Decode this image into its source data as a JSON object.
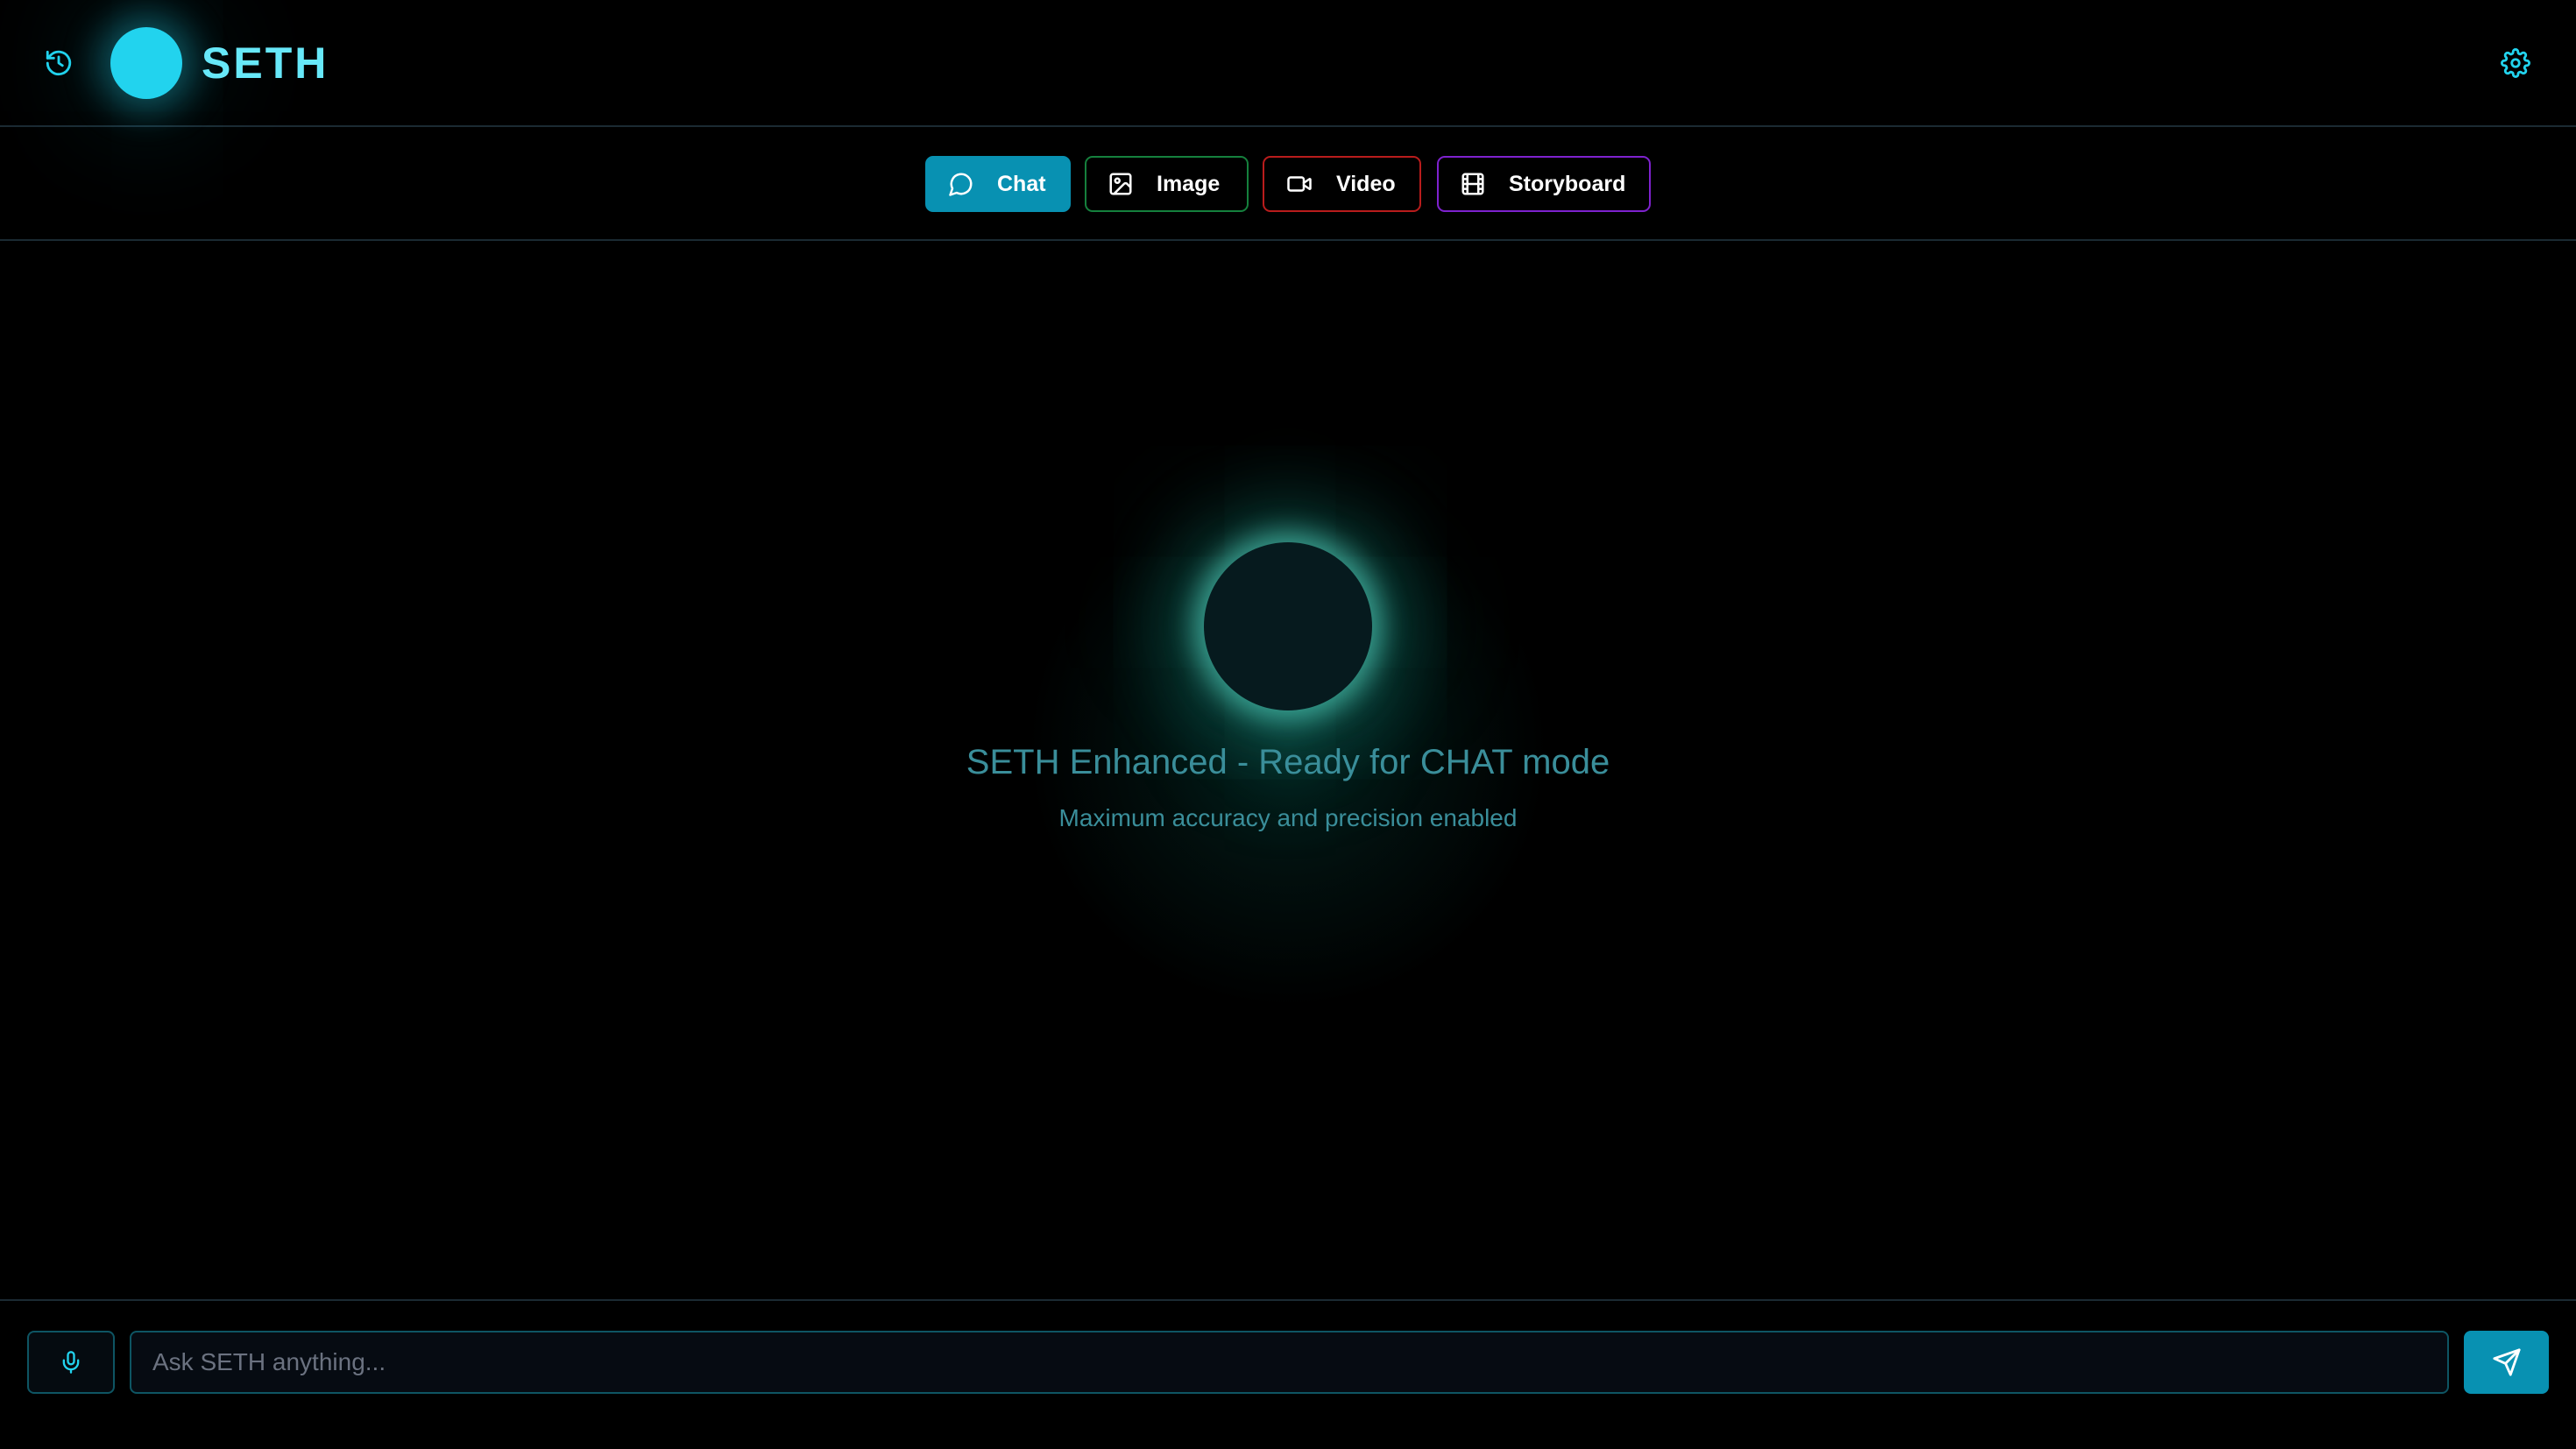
{
  "header": {
    "brand": "SETH",
    "history_icon": "history-icon",
    "settings_icon": "gear-icon",
    "logo_color": "#22d3ee"
  },
  "modes": {
    "active": "Chat",
    "tabs": [
      {
        "label": "Chat",
        "icon": "chat-bubble-icon",
        "accent": "#0891b2"
      },
      {
        "label": "Image",
        "icon": "image-icon",
        "accent": "#15803d"
      },
      {
        "label": "Video",
        "icon": "video-camera-icon",
        "accent": "#b91c1c"
      },
      {
        "label": "Storyboard",
        "icon": "film-icon",
        "accent": "#7e22ce"
      }
    ]
  },
  "main": {
    "headline": "SETH Enhanced - Ready for CHAT mode",
    "subline": "Maximum accuracy and precision enabled",
    "text_color": "#3a8e9a",
    "orb_glow_color": "#5eead4"
  },
  "composer": {
    "placeholder": "Ask SETH anything...",
    "value": "",
    "mic_icon": "microphone-icon",
    "send_icon": "send-icon",
    "accent": "#0891b2"
  }
}
